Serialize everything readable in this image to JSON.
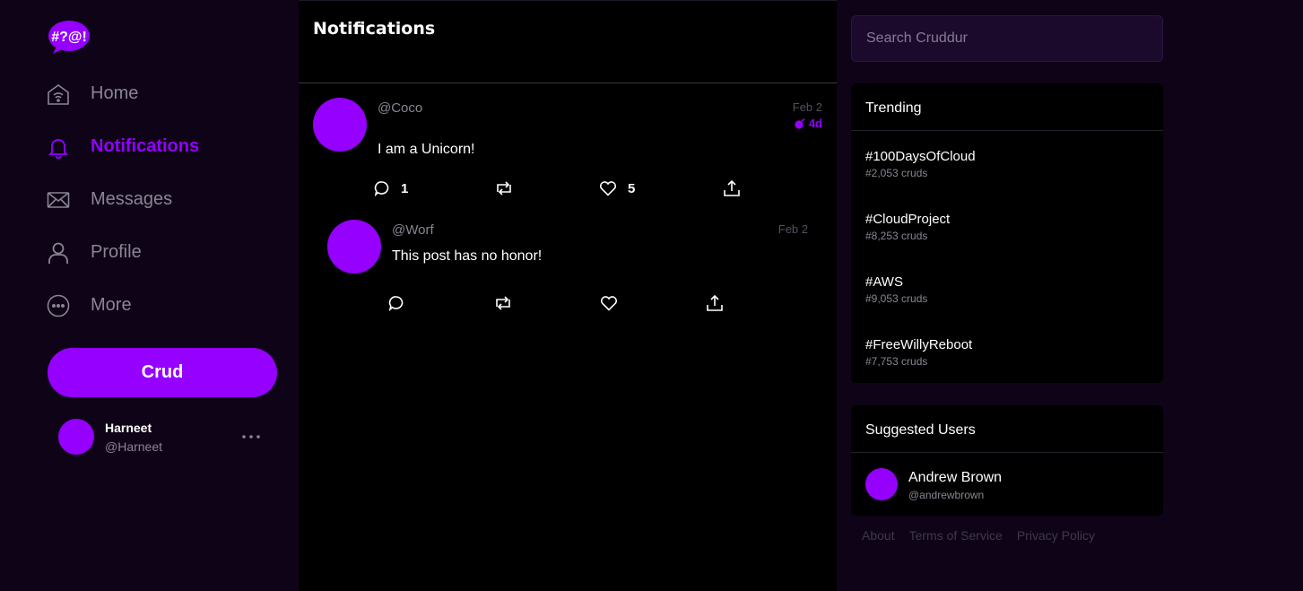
{
  "app": {
    "logo_text": "#?@!",
    "colors": {
      "accent": "#9500ff",
      "background": "#0e0317",
      "feed": "#000000",
      "muted": "#8a8593"
    }
  },
  "sidebar": {
    "nav": [
      {
        "label": "Home",
        "icon": "home-icon",
        "active": false
      },
      {
        "label": "Notifications",
        "icon": "bell-icon",
        "active": true
      },
      {
        "label": "Messages",
        "icon": "envelope-icon",
        "active": false
      },
      {
        "label": "Profile",
        "icon": "user-icon",
        "active": false
      },
      {
        "label": "More",
        "icon": "more-circle-icon",
        "active": false
      }
    ],
    "crud_button": "Crud",
    "profile": {
      "name": "Harneet",
      "handle": "@Harneet"
    }
  },
  "main": {
    "title": "Notifications",
    "activities": [
      {
        "handle": "@Coco",
        "date": "Feb 2",
        "expires": "4d",
        "message": "I am a Unicorn!",
        "replies": "1",
        "likes": "5"
      },
      {
        "handle": "@Worf",
        "date": "Feb 2",
        "message": "This post has no honor!"
      }
    ]
  },
  "right": {
    "search_placeholder": "Search Cruddur",
    "trending": {
      "title": "Trending",
      "items": [
        {
          "tag": "#100DaysOfCloud",
          "count": "#2,053 cruds"
        },
        {
          "tag": "#CloudProject",
          "count": "#8,253 cruds"
        },
        {
          "tag": "#AWS",
          "count": "#9,053 cruds"
        },
        {
          "tag": "#FreeWillyReboot",
          "count": "#7,753 cruds"
        }
      ]
    },
    "suggested": {
      "title": "Suggested Users",
      "users": [
        {
          "name": "Andrew Brown",
          "handle": "@andrewbrown"
        }
      ]
    },
    "footer": {
      "about": "About",
      "terms": "Terms of Service",
      "privacy": "Privacy Policy"
    }
  }
}
